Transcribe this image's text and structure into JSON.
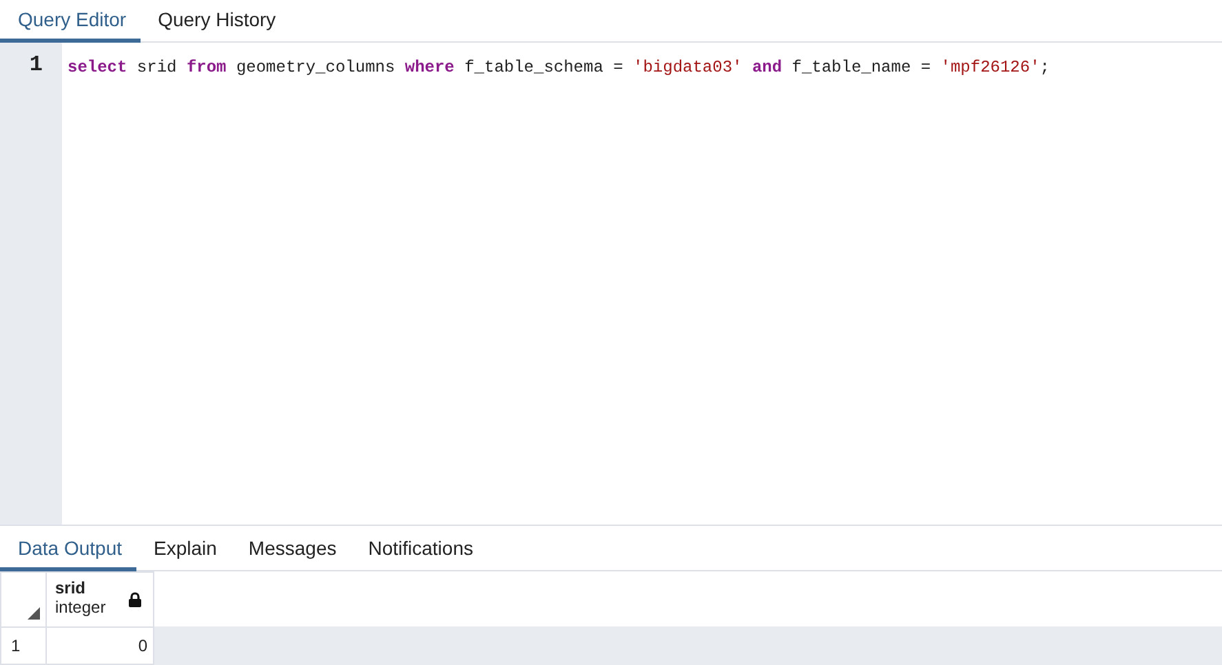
{
  "editor_tabs": [
    {
      "label": "Query Editor",
      "selected": true
    },
    {
      "label": "Query History",
      "selected": false
    }
  ],
  "editor": {
    "lines": [
      {
        "number": "1",
        "tokens": [
          {
            "kind": "keyword",
            "text": "select"
          },
          {
            "kind": "plain",
            "text": " srid "
          },
          {
            "kind": "keyword",
            "text": "from"
          },
          {
            "kind": "plain",
            "text": " geometry_columns "
          },
          {
            "kind": "keyword",
            "text": "where"
          },
          {
            "kind": "plain",
            "text": " f_table_schema = "
          },
          {
            "kind": "string",
            "text": "'bigdata03' "
          },
          {
            "kind": "keyword",
            "text": "and"
          },
          {
            "kind": "plain",
            "text": " f_table_name = "
          },
          {
            "kind": "string",
            "text": "'mpf26126'"
          },
          {
            "kind": "plain",
            "text": ";"
          }
        ]
      }
    ]
  },
  "output_tabs": [
    {
      "label": "Data Output",
      "selected": true
    },
    {
      "label": "Explain",
      "selected": false
    },
    {
      "label": "Messages",
      "selected": false
    },
    {
      "label": "Notifications",
      "selected": false
    }
  ],
  "table": {
    "columns": [
      {
        "name": "srid",
        "type": "integer",
        "locked": true
      }
    ],
    "rows": [
      {
        "number": "1",
        "cells": [
          "0"
        ]
      }
    ]
  }
}
